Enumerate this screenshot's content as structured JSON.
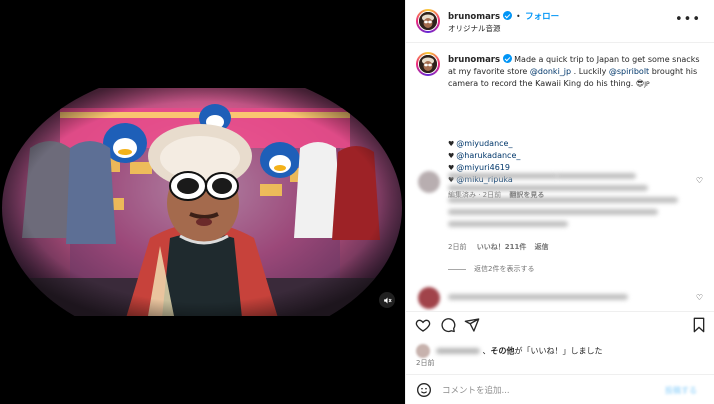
{
  "header": {
    "username": "brunomars",
    "separator": "•",
    "follow_label": "フォロー",
    "subtitle": "オリジナル音源",
    "more_icon": "more-horizontal-icon"
  },
  "caption": {
    "username": "brunomars",
    "text_1": "Made a quick trip to Japan to get some snacks at my favorite store ",
    "store_handle": "@donki_jp",
    "text_2": " . Luckily ",
    "friend_handle": "@spiribolt",
    "text_3": " brought his camera to record the Kawaii King do his thing. 😎",
    "flag": "JP",
    "mentions": [
      {
        "heart": "♥",
        "handle": "@miyudance_"
      },
      {
        "heart": "♥",
        "handle": "@harukadance_"
      },
      {
        "heart": "♥",
        "handle": "@miyuri4619"
      },
      {
        "heart": "♥",
        "handle": "@miku_ripuka"
      }
    ],
    "edited_label": "編集済み · 2日前",
    "translate_label": "翻訳を見る"
  },
  "comment": {
    "time": "2日前",
    "likes_label": "いいね！211件",
    "reply_label": "返信",
    "view_replies_label": "返信2件を表示する"
  },
  "actions": {
    "liked_others": "その他",
    "liked_suffix": "が「いいね！」しました",
    "liked_sep": "、",
    "date": "2日前"
  },
  "comment_box": {
    "placeholder": "コメントを追加...",
    "post_label": "投稿する"
  },
  "colors": {
    "accent": "#0095f6",
    "link": "#00376b",
    "muted": "#737373",
    "border": "#efefef"
  },
  "icons": [
    "heart-icon",
    "comment-icon",
    "share-icon",
    "bookmark-icon",
    "emoji-icon",
    "mute-icon",
    "verified-icon"
  ]
}
